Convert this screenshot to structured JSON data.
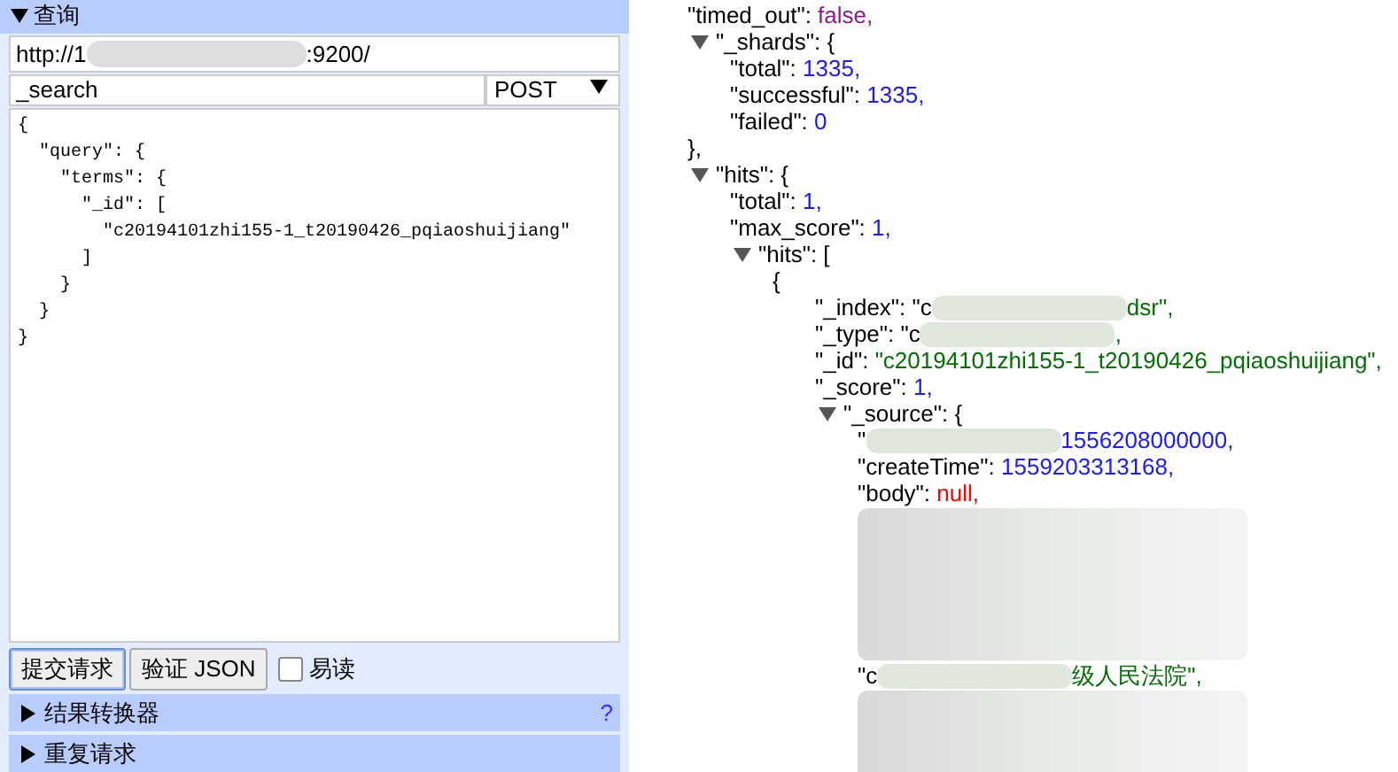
{
  "query_panel": {
    "title": "查询",
    "expanded": true,
    "url": {
      "start": "http://1",
      "end": ":9200/"
    },
    "path": {
      "value": "_search"
    },
    "method": {
      "value": "POST"
    },
    "body": "{\n  \"query\": {\n    \"terms\": {\n      \"_id\": [\n        \"c20194101zhi155-1_t20190426_pqiaoshuijiang\"\n      ]\n    }\n  }\n}",
    "buttons": [
      {
        "label": "提交请求",
        "selected": true
      },
      {
        "label": "验证 JSON",
        "selected": false
      }
    ],
    "readable": {
      "label": "易读",
      "checked": false
    },
    "sections": [
      {
        "title": "结果转换器",
        "expanded": false,
        "help": "?"
      },
      {
        "title": "重复请求",
        "expanded": false
      }
    ]
  },
  "result": [
    {
      "kind": "bool",
      "key": "\"timed_out\": ",
      "value": "false,"
    },
    {
      "kind": "open",
      "key": "\"_shards\": ",
      "bracket": "{",
      "expanded": true,
      "close": "},",
      "children": [
        {
          "kind": "number",
          "key": "\"total\": ",
          "value": "1335,"
        },
        {
          "kind": "number",
          "key": "\"successful\": ",
          "value": "1335,"
        },
        {
          "kind": "number",
          "key": "\"failed\": ",
          "value": "0"
        }
      ]
    },
    {
      "kind": "open",
      "key": "\"hits\": ",
      "bracket": "{",
      "expanded": true,
      "children": [
        {
          "kind": "number",
          "key": "\"total\": ",
          "value": "1,"
        },
        {
          "kind": "number",
          "key": "\"max_score\": ",
          "value": "1,"
        },
        {
          "kind": "open",
          "key": "\"hits\": ",
          "bracket": "[",
          "expanded": true,
          "children": [
            {
              "kind": "open",
              "bracket": "{",
              "children": [
                {
                  "kind": "maskedstring",
                  "key": "\"_index\": ",
                  "before": "\"c",
                  "after": "dsr\","
                },
                {
                  "kind": "maskedstring",
                  "key": "\"_type\": ",
                  "before": "\"c",
                  "after": ","
                },
                {
                  "kind": "string",
                  "key": "\"_id\": ",
                  "value": "\"c20194101zhi155-1_t20190426_pqiaoshuijiang\","
                },
                {
                  "kind": "number",
                  "key": "\"_score\": ",
                  "value": "1,"
                },
                {
                  "kind": "open",
                  "key": "\"_source\": ",
                  "bracket": "{",
                  "expanded": true,
                  "children": [
                    {
                      "kind": "maskednumber",
                      "key": "\"",
                      "after": "1556208000000,"
                    },
                    {
                      "kind": "number",
                      "key": "\"createTime\": ",
                      "value": "1559203313168,"
                    },
                    {
                      "kind": "null",
                      "key": "\"body\": ",
                      "value": "null,"
                    },
                    {
                      "kind": "tallblur"
                    },
                    {
                      "kind": "maskedstring",
                      "key": "\"c",
                      "after": "级人民法院\","
                    },
                    {
                      "kind": "shortblur"
                    }
                  ]
                }
              ]
            }
          ]
        }
      ]
    }
  ]
}
